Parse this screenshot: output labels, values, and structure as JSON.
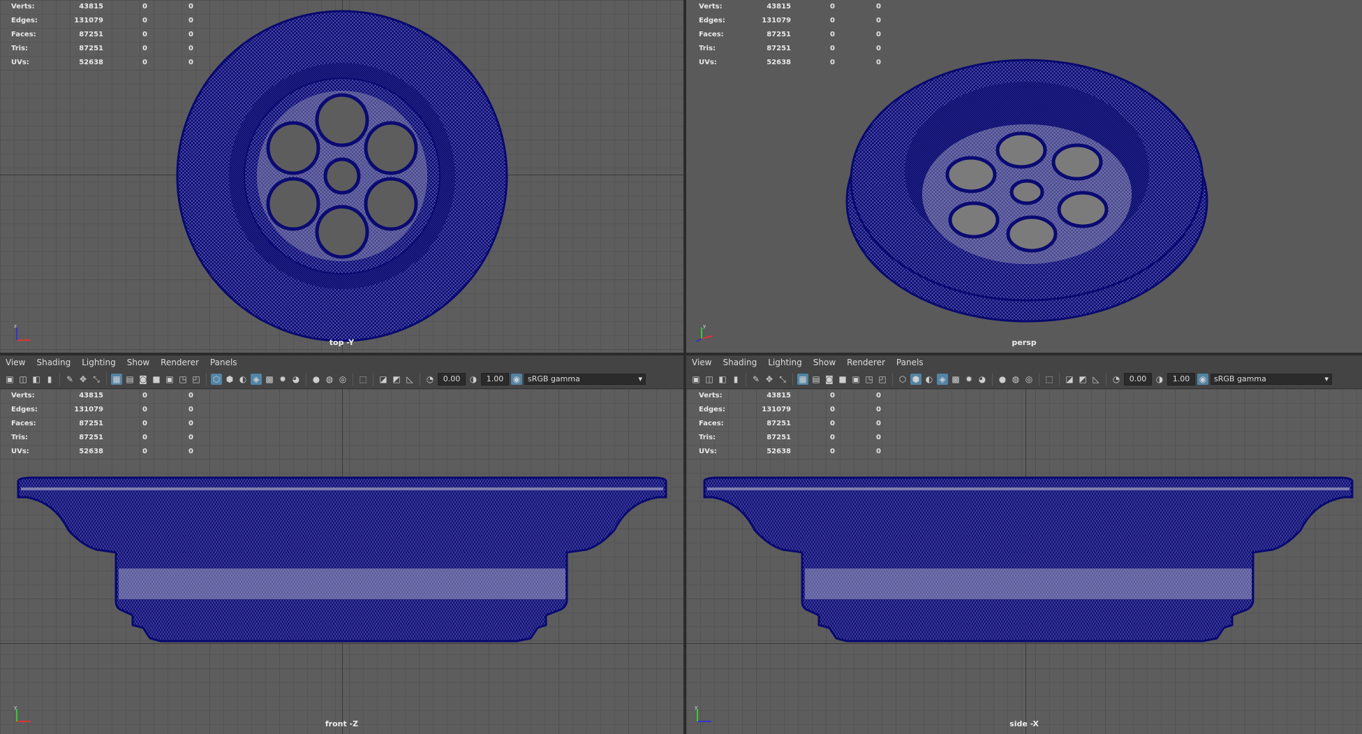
{
  "stats": {
    "rows": [
      {
        "label": "Verts:",
        "v1": "43815",
        "v2": "0",
        "v3": "0"
      },
      {
        "label": "Edges:",
        "v1": "131079",
        "v2": "0",
        "v3": "0"
      },
      {
        "label": "Faces:",
        "v1": "87251",
        "v2": "0",
        "v3": "0"
      },
      {
        "label": "Tris:",
        "v1": "87251",
        "v2": "0",
        "v3": "0"
      },
      {
        "label": "UVs:",
        "v1": "52638",
        "v2": "0",
        "v3": "0"
      }
    ]
  },
  "viewports": {
    "top": {
      "camera": "top -Y"
    },
    "persp": {
      "camera": "persp"
    },
    "front": {
      "camera": "front -Z"
    },
    "side": {
      "camera": "side -X"
    }
  },
  "panel_menu": {
    "view": "View",
    "shading": "Shading",
    "lighting": "Lighting",
    "show": "Show",
    "renderer": "Renderer",
    "panels": "Panels"
  },
  "panel_toolbar": {
    "exposure": "0.00",
    "gamma": "1.00",
    "color_space": "sRGB gamma"
  },
  "icons": [
    "camera-icon",
    "grid-icon",
    "wireframe-icon",
    "smooth-shade-icon",
    "xray-icon",
    "light-icon",
    "isolate-icon",
    "color-management-icon",
    "chevron-down-icon",
    "axis-gizmo-icon"
  ],
  "colors": {
    "wire": "#0a0a7a",
    "viewport_bg": "#5d5d5d",
    "menu_bg": "#444444",
    "accent": "#5285a6"
  }
}
